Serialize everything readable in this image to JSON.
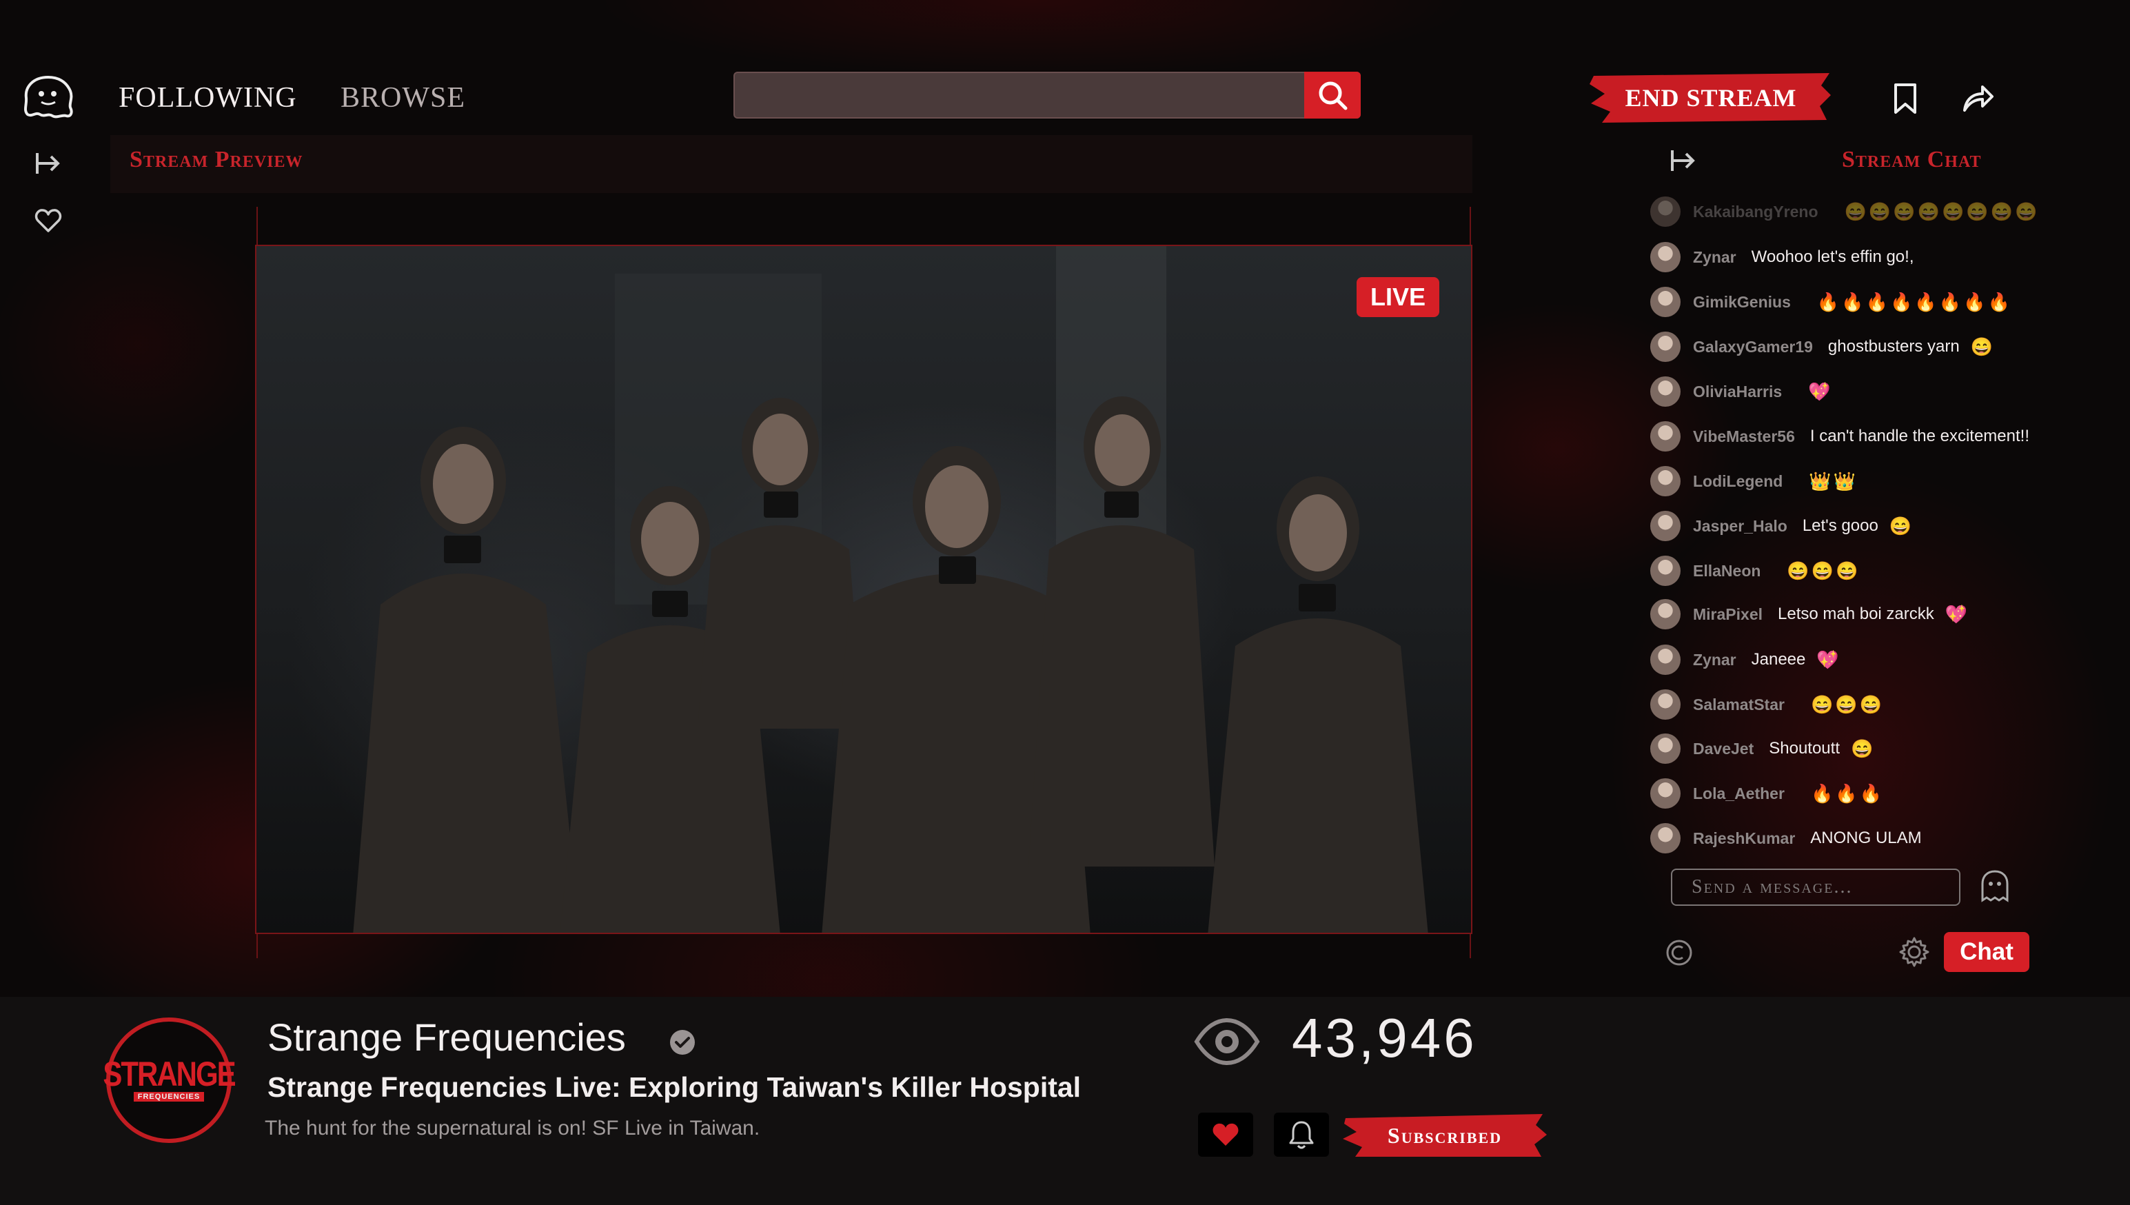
{
  "header": {
    "nav": [
      {
        "label": "FOLLOWING"
      },
      {
        "label": "BROWSE"
      }
    ],
    "search": {
      "placeholder": "",
      "value": ""
    },
    "end_stream_label": "END STREAM"
  },
  "preview": {
    "heading": "Stream Preview",
    "live_label": "LIVE"
  },
  "chat": {
    "heading": "Stream Chat",
    "messages": [
      {
        "user": "KakaibangYreno",
        "text": "",
        "emoji": "😄😄😄😄😄😄😄😄"
      },
      {
        "user": "Zynar",
        "text": "Woohoo let's effin go!,",
        "emoji": ""
      },
      {
        "user": "GimikGenius",
        "text": "",
        "emoji": "🔥🔥🔥🔥🔥🔥🔥🔥"
      },
      {
        "user": "GalaxyGamer19",
        "text": "ghostbusters yarn",
        "emoji": "😄"
      },
      {
        "user": "OliviaHarris",
        "text": "",
        "emoji": "💖"
      },
      {
        "user": "VibeMaster56",
        "text": "I can't handle the excitement!!",
        "emoji": ""
      },
      {
        "user": "LodiLegend",
        "text": "",
        "emoji": "👑👑"
      },
      {
        "user": "Jasper_Halo",
        "text": "Let's gooo",
        "emoji": "😄"
      },
      {
        "user": "EllaNeon",
        "text": "",
        "emoji": "😄😄😄"
      },
      {
        "user": "MiraPixel",
        "text": "Letso mah boi zarckk",
        "emoji": "💖"
      },
      {
        "user": "Zynar",
        "text": "Janeee",
        "emoji": "💖"
      },
      {
        "user": "SalamatStar",
        "text": "",
        "emoji": "😄😄😄"
      },
      {
        "user": "DaveJet",
        "text": "Shoutoutt",
        "emoji": "😄"
      },
      {
        "user": "Lola_Aether",
        "text": "",
        "emoji": "🔥🔥🔥"
      },
      {
        "user": "RajeshKumar",
        "text": "ANONG ULAM",
        "emoji": ""
      }
    ],
    "input_placeholder": "Send a message...",
    "send_label": "Chat"
  },
  "channel": {
    "logo_line1": "STRANGE",
    "logo_line2": "FREQUENCIES",
    "name": "Strange Frequencies",
    "stream_title": "Strange Frequencies Live: Exploring Taiwan's Killer Hospital",
    "description": "The hunt for the supernatural is on! SF Live in Taiwan.",
    "viewer_count": "43,946",
    "subscribe_label": "Subscribed"
  },
  "colors": {
    "accent": "#d61f26",
    "background": "#0b0808",
    "info_bar": "#121010",
    "heading_red": "#c8242b"
  }
}
